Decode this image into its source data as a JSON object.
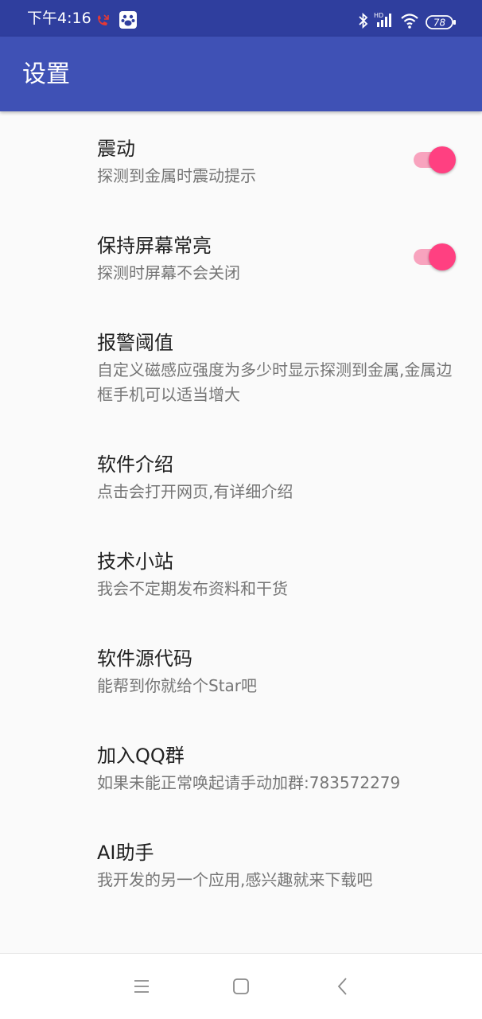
{
  "status_bar": {
    "time": "下午4:16",
    "battery": "78",
    "icons": [
      "missed-call-icon",
      "baidu-paw-icon",
      "bluetooth-icon",
      "hd-signal-icon",
      "wifi-icon",
      "battery-icon"
    ],
    "background": "#2f3e9e"
  },
  "appbar": {
    "title": "设置",
    "color": "#3f51b5"
  },
  "settings": [
    {
      "title": "震动",
      "summary": "探测到金属时震动提示",
      "switch_on": true
    },
    {
      "title": "保持屏幕常亮",
      "summary": "探测时屏幕不会关闭",
      "switch_on": true
    },
    {
      "title": "报警阈值",
      "summary": "自定义磁感应强度为多少时显示探测到金属,金属边框手机可以适当增大"
    },
    {
      "title": "软件介绍",
      "summary": "点击会打开网页,有详细介绍"
    },
    {
      "title": "技术小站",
      "summary": "我会不定期发布资料和干货"
    },
    {
      "title": "软件源代码",
      "summary": "能帮到你就给个Star吧"
    },
    {
      "title": "加入QQ群",
      "summary": "如果未能正常唤起请手动加群:783572279"
    },
    {
      "title": "AI助手",
      "summary": "我开发的另一个应用,感兴趣就来下载吧"
    }
  ],
  "nav_bar": {
    "buttons": [
      "menu-icon",
      "home-icon",
      "back-icon"
    ]
  },
  "colors": {
    "accent": "#ff4081",
    "title_text": "#212121",
    "summary_text": "#757575"
  }
}
